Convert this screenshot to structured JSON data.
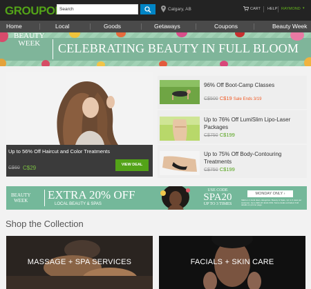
{
  "header": {
    "logo": "GROUPON",
    "search_value": "Search",
    "location": "Calgary, AB",
    "cart": "CART",
    "help": "HELP",
    "user": "RAYMOND"
  },
  "nav": {
    "items": [
      "Home",
      "Local",
      "Goods",
      "Getaways",
      "Coupons",
      "Beauty Week"
    ]
  },
  "banner": {
    "badge_line1": "BEAUTY",
    "badge_line2": "WEEK",
    "title": "CELEBRATING BEAUTY IN FULL BLOOM"
  },
  "main_deal": {
    "title": "Up to 56% Off Haircut and Color Treatments",
    "old_price": "C$60",
    "new_price": "C$29",
    "button": "VIEW DEAL"
  },
  "side_deals": [
    {
      "title": "96% Off Boot-Camp Classes",
      "old_price": "C$500",
      "new_price": "C$19",
      "note": "Sale Ends 3/19"
    },
    {
      "title": "Up to 76% Off LumiSlim Lipo-Laser Packages",
      "old_price": "C$750",
      "new_price": "C$199"
    },
    {
      "title": "Up to 75% Off Body-Contouring Treatments",
      "old_price": "C$750",
      "new_price": "C$199"
    }
  ],
  "promo": {
    "badge_line1": "BEAUTY",
    "badge_line2": "WEEK",
    "headline": "EXTRA 20% OFF",
    "sub": "LOCAL BEAUTY & SPAS",
    "code_label": "USE CODE",
    "code": "SPA20",
    "code_note": "UP TO 3 TIMES",
    "monday": "MONDAY ONLY",
    "fine_print": "Valid on 1 local deal, categories: Beauty & Spas, Up to 3 uses per customer. Up to $20 off. Ends 3/19. Some deals excluded. Full details on promo page."
  },
  "shop": {
    "title": "Shop the Collection",
    "collections": [
      "MASSAGE + SPA SERVICES",
      "FACIALS + SKIN CARE"
    ]
  },
  "colors": {
    "brand_green": "#53a318",
    "header_dark": "#232323",
    "nav": "#4a4a4a",
    "search_blue": "#0185c6",
    "sale_orange": "#f15a24",
    "banner_mint": "#9ccfb1"
  }
}
